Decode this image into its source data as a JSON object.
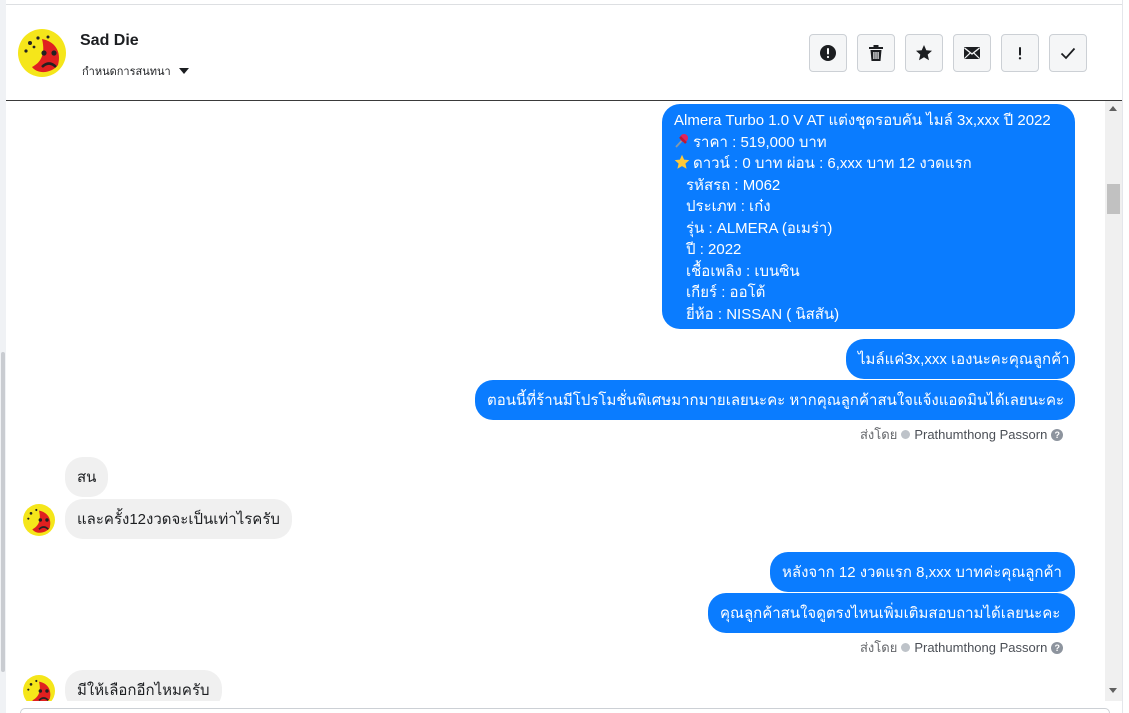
{
  "header": {
    "contact_name": "Sad Die",
    "subtitle": "กำหนดการสนทนา",
    "actions": [
      {
        "name": "mark-spam-button",
        "icon": "alert-circle-icon"
      },
      {
        "name": "delete-button",
        "icon": "trash-icon"
      },
      {
        "name": "star-button",
        "icon": "star-icon"
      },
      {
        "name": "mark-unread-button",
        "icon": "envelope-icon"
      },
      {
        "name": "follow-up-button",
        "icon": "exclamation-icon"
      },
      {
        "name": "mark-done-button",
        "icon": "checkmark-icon"
      }
    ]
  },
  "messages": {
    "listing": {
      "title": "Almera Turbo 1.0 V AT แต่งชุดรอบคัน ไมล์ 3x,xxx ปี 2022",
      "price": "ราคา : 519,000 บาท",
      "down": "ดาวน์ : 0 บาท ผ่อน : 6,xxx บาท 12 งวดแรก",
      "code": "รหัสรถ : M062",
      "type": "ประเภท : เก๋ง",
      "model": "รุ่น : ALMERA (อเมร่า)",
      "year": "ปี : 2022",
      "fuel": "เชื้อเพลิง : เบนซิน",
      "gear": "เกียร์ : ออโต้",
      "brand": "ยี่ห้อ : NISSAN ( นิสสัน)"
    },
    "out_mileage": "ไมล์แค่3x,xxx เองนะคะคุณลูกค้า",
    "out_promo": "ตอนนี้ที่ร้านมีโปรโมชั่นพิเศษมากมายเลยนะคะ หากคุณลูกค้าสนใจแจ้งแอดมินได้เลยนะคะ",
    "sent_by_label": "ส่งโดย",
    "agent_name": "Prathumthong Passorn",
    "in_interested": "สน",
    "in_question": "และครั้ง12งวดจะเป็นเท่าไรครับ",
    "out_after12": "หลังจาก 12 งวดแรก 8,xxx บาทค่ะคุณลูกค้า",
    "out_more": "คุณลูกค้าสนใจดูตรงไหนเพิ่มเติมสอบถามได้เลยนะคะ",
    "in_options": "มีให้เลือกอีกไหมครับ"
  },
  "colors": {
    "outgoing_bubble": "#0a7cff",
    "incoming_bubble": "#f0f0f0"
  }
}
